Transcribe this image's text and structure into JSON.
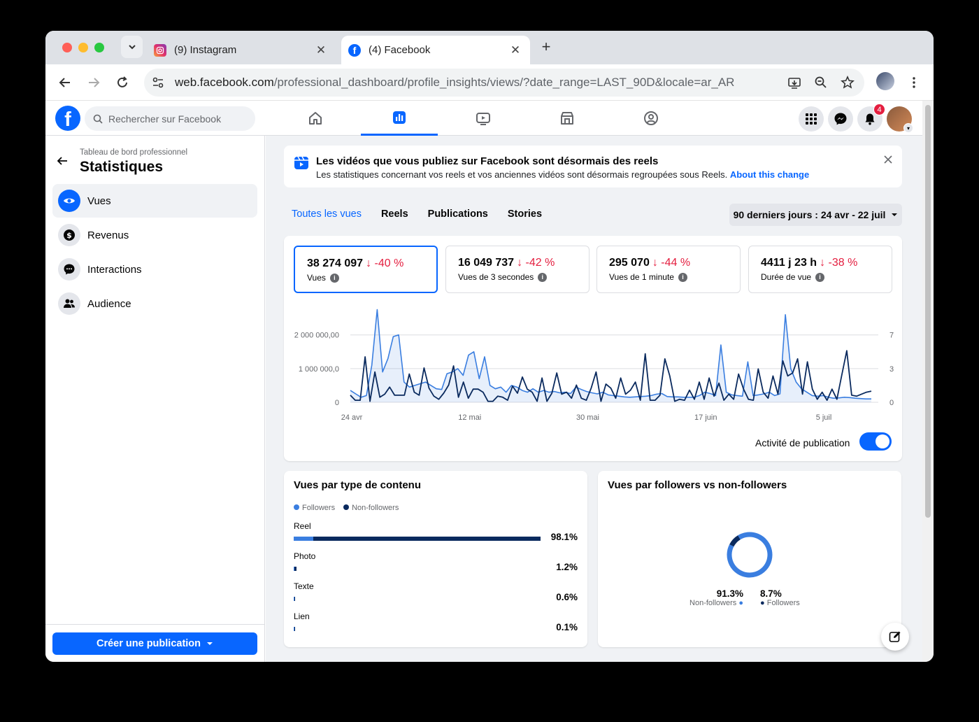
{
  "browser": {
    "tabs": [
      {
        "title": "(9) Instagram",
        "favicon": "instagram-icon",
        "active": false
      },
      {
        "title": "(4) Facebook",
        "favicon": "facebook-icon",
        "active": true
      }
    ],
    "url_host": "web.facebook.com",
    "url_path": "/professional_dashboard/profile_insights/views/?date_range=LAST_90D&locale=ar_AR"
  },
  "fb": {
    "search_placeholder": "Rechercher sur Facebook",
    "notif_count": "4",
    "brand_color": "#0866ff"
  },
  "sidebar": {
    "subtitle": "Tableau de bord professionnel",
    "title": "Statistiques",
    "items": [
      {
        "label": "Vues",
        "icon": "eye-icon",
        "active": true
      },
      {
        "label": "Revenus",
        "icon": "dollar-icon",
        "active": false
      },
      {
        "label": "Interactions",
        "icon": "chat-icon",
        "active": false
      },
      {
        "label": "Audience",
        "icon": "people-icon",
        "active": false
      }
    ],
    "create_label": "Créer une publication"
  },
  "banner": {
    "title": "Les vidéos que vous publiez sur Facebook sont désormais des reels",
    "text": "Les statistiques concernant vos reels et vos anciennes vidéos sont désormais regroupées sous Reels.",
    "link": "About this change"
  },
  "subtabs": [
    "Toutes les vues",
    "Reels",
    "Publications",
    "Stories"
  ],
  "date_range": "90 derniers jours : 24 avr - 22 juil",
  "metrics": [
    {
      "value": "38 274 097",
      "delta": "↓ -40 %",
      "label": "Vues"
    },
    {
      "value": "16 049 737",
      "delta": "↓ -42 %",
      "label": "Vues de 3 secondes"
    },
    {
      "value": "295 070",
      "delta": "↓ -44 %",
      "label": "Vues de 1 minute"
    },
    {
      "value": "4411 j 23 h",
      "delta": "↓ -38 %",
      "label": "Durée de vue"
    }
  ],
  "toggle_label": "Activité de publication",
  "chart_data": {
    "type": "line",
    "y_left_ticks": [
      "2 000 000,00",
      "1 000 000,0",
      "0"
    ],
    "y_right_ticks": [
      "7",
      "3",
      "0"
    ],
    "x_ticks": [
      "24 avr",
      "12 mai",
      "30 mai",
      "17 juin",
      "5 juil"
    ],
    "ylim_left": [
      0,
      2700000
    ],
    "ylim_right": [
      0,
      9
    ],
    "series": [
      {
        "color": "#3a7ee0",
        "axis": "left",
        "values": [
          350000,
          250000,
          150000,
          200000,
          1100000,
          2750000,
          900000,
          1300000,
          1950000,
          2000000,
          600000,
          450000,
          500000,
          550000,
          600000,
          500000,
          400000,
          380000,
          850000,
          900000,
          1000000,
          800000,
          1400000,
          1500000,
          700000,
          1350000,
          500000,
          400000,
          450000,
          300000,
          500000,
          450000,
          350000,
          300000,
          400000,
          300000,
          350000,
          300000,
          320000,
          280000,
          300000,
          260000,
          450000,
          380000,
          320000,
          280000,
          250000,
          300000,
          220000,
          200000,
          180000,
          160000,
          150000,
          160000,
          170000,
          180000,
          200000,
          240000,
          260000,
          170000,
          160000,
          160000,
          150000,
          150000,
          150000,
          200000,
          300000,
          260000,
          200000,
          1700000,
          300000,
          220000,
          200000,
          180000,
          1200000,
          200000,
          220000,
          250000,
          300000,
          200000,
          250000,
          2600000,
          1000000,
          600000,
          400000,
          300000,
          200000,
          180000,
          200000,
          150000,
          120000,
          130000,
          150000,
          140000,
          120000,
          110000,
          100000,
          100000
        ],
        "label": ""
      },
      {
        "color": "#0a2a5e",
        "axis": "right",
        "values": [
          0.7,
          0.2,
          0.2,
          4.5,
          0.1,
          3.0,
          0.5,
          0.8,
          1.5,
          0.7,
          0.7,
          0.7,
          2.8,
          1.0,
          0.7,
          3.4,
          1.4,
          0.6,
          0.3,
          0.9,
          1.7,
          3.6,
          0.5,
          2.0,
          0.4,
          1.3,
          1.3,
          1.0,
          0.1,
          0.1,
          0.6,
          0.5,
          0.2,
          1.6,
          0.9,
          2.5,
          1.3,
          1.0,
          0.1,
          2.4,
          0.1,
          0.9,
          2.9,
          0.8,
          1.0,
          0.4,
          1.7,
          0.4,
          0.2,
          1.4,
          3.0,
          0.1,
          1.8,
          1.4,
          0.4,
          2.4,
          0.8,
          1.2,
          2.0,
          0.2,
          4.8,
          0.2,
          0.2,
          0.7,
          4.3,
          2.6,
          0.1,
          0.3,
          0.2,
          1.2,
          0.3,
          2.0,
          0.3,
          2.4,
          0.6,
          1.9,
          0.2,
          0.8,
          0.3,
          2.8,
          1.3,
          0.3,
          0.2,
          3.3,
          1.0,
          0.4,
          2.6,
          0.8,
          4.1,
          2.6,
          2.9,
          4.3,
          0.8,
          4.0,
          1.3,
          0.3,
          1.0,
          0.2,
          1.3,
          0.3,
          2.7,
          5.1,
          0.7,
          0.6,
          0.8,
          1.0,
          1.1
        ]
      }
    ]
  },
  "content_type_chart": {
    "title": "Vues par type de contenu",
    "legend": [
      {
        "name": "Followers",
        "color": "#3a7ee0"
      },
      {
        "name": "Non-followers",
        "color": "#0a2a5e"
      }
    ],
    "rows": [
      {
        "name": "Reel",
        "pct": "98.1%",
        "followers_fraction": 0.079,
        "total_fraction": 1.0
      },
      {
        "name": "Photo",
        "pct": "1.2%",
        "followers_fraction": 0.2,
        "total_fraction": 0.012
      },
      {
        "name": "Texte",
        "pct": "0.6%",
        "followers_fraction": 0.3,
        "total_fraction": 0.006
      },
      {
        "name": "Lien",
        "pct": "0.1%",
        "followers_fraction": 0.5,
        "total_fraction": 0.003
      }
    ]
  },
  "followers_chart": {
    "title": "Vues par followers vs non-followers",
    "slices": [
      {
        "name": "Non-followers",
        "pct": "91.3%",
        "value": 91.3,
        "color": "#3a7ee0"
      },
      {
        "name": "Followers",
        "pct": "8.7%",
        "value": 8.7,
        "color": "#0a2a5e"
      }
    ]
  }
}
